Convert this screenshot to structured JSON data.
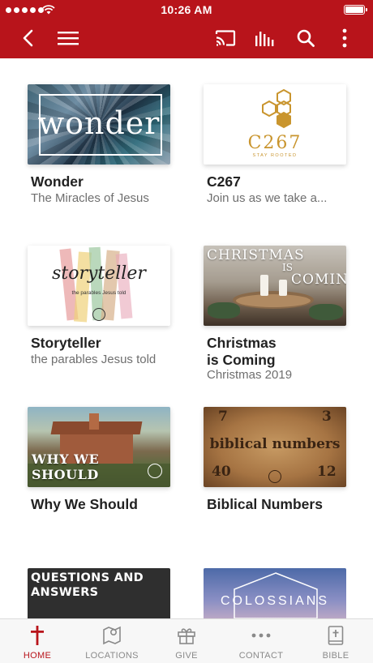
{
  "status_bar": {
    "time": "10:26 AM"
  },
  "nav": {
    "back_icon": "chevron-left-icon",
    "menu_icon": "hamburger-menu-icon",
    "cast_icon": "cast-icon",
    "audio_icon": "audio-bars-icon",
    "search_icon": "search-icon",
    "more_icon": "more-vertical-icon"
  },
  "colors": {
    "brand": "#b8141b",
    "tab_inactive": "#8a8a8a"
  },
  "series": [
    {
      "title": "Wonder",
      "subtitle": "The Miracles of Jesus",
      "art_text": "wonder"
    },
    {
      "title": "C267",
      "subtitle": "Join us as we take a...",
      "art_text": "C267",
      "art_tag": "STAY ROOTED"
    },
    {
      "title": "Storyteller",
      "subtitle": "the parables Jesus told",
      "art_text": "storyteller",
      "art_tag": "the parables Jesus told"
    },
    {
      "title": "Christmas\nis Coming",
      "title_line1": "Christmas",
      "title_line2": "is Coming",
      "subtitle": "Christmas 2019",
      "art_l1": "CHRISTMAS",
      "art_l2": "IS",
      "art_l3": "COMING"
    },
    {
      "title": "Why We Should",
      "subtitle": "",
      "art_l1": "WHY WE",
      "art_l2": "SHOULD"
    },
    {
      "title": "Biblical Numbers",
      "subtitle": "",
      "art_text": "biblical numbers",
      "n1": "7",
      "n2": "3",
      "n3": "40",
      "n4": "12"
    },
    {
      "title": "",
      "subtitle": "",
      "art_l1": "QUESTIONS AND",
      "art_l2": "ANSWERS"
    },
    {
      "title": "",
      "subtitle": "",
      "art_text": "COLOSSIANS"
    }
  ],
  "tabs": [
    {
      "label": "HOME",
      "icon": "cross-icon",
      "active": true
    },
    {
      "label": "LOCATIONS",
      "icon": "map-pin-icon",
      "active": false
    },
    {
      "label": "GIVE",
      "icon": "gift-icon",
      "active": false
    },
    {
      "label": "CONTACT",
      "icon": "ellipsis-icon",
      "active": false
    },
    {
      "label": "BIBLE",
      "icon": "bible-icon",
      "active": false
    }
  ]
}
